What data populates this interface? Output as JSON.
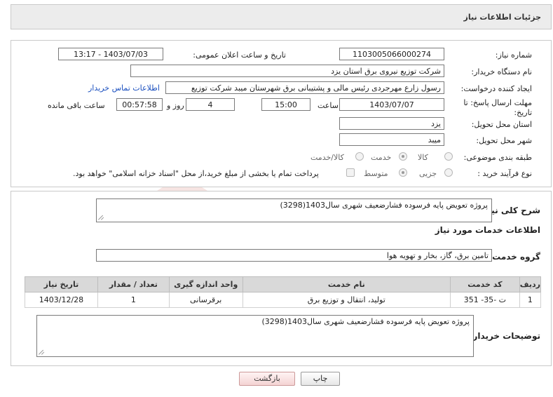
{
  "header": {
    "title": "جزئیات اطلاعات نیاز"
  },
  "fields": {
    "need_number_label": "شماره نیاز:",
    "need_number": "1103005066000274",
    "announce_label": "تاریخ و ساعت اعلان عمومی:",
    "announce_value": "1403/07/03 - 13:17",
    "buyer_org_label": "نام دستگاه خریدار:",
    "buyer_org": "شرکت توزیع نیروی برق استان یزد",
    "creator_label": "ایجاد کننده درخواست:",
    "creator": "رسول  زارع مهرجردی  رئیس مالی و پشتیبانی برق شهرستان میبد شرکت توزیع",
    "contact_link": "اطلاعات تماس خریدار",
    "deadline_label": "مهلت ارسال پاسخ: تا تاریخ:",
    "deadline_date": "1403/07/07",
    "time_label": "ساعت",
    "deadline_time": "15:00",
    "days_value": "4",
    "days_label": "روز و",
    "remaining_time": "00:57:58",
    "remaining_label": "ساعت باقی مانده",
    "province_label": "استان محل تحویل:",
    "province": "یزد",
    "city_label": "شهر محل تحویل:",
    "city": "میبد",
    "category_label": "طبقه بندی موضوعی:",
    "category_options": [
      "کالا",
      "خدمت",
      "کالا/خدمت"
    ],
    "category_selected": "خدمت",
    "purchase_label": "نوع فرآیند خرید :",
    "purchase_options": [
      "جزیی",
      "متوسط"
    ],
    "purchase_selected": "متوسط",
    "payment_note": "پرداخت تمام یا بخشی از مبلغ خرید،از محل \"اسناد خزانه اسلامی\" خواهد بود."
  },
  "description": {
    "summary_label": "شرح کلی نیاز:",
    "summary": "پروژه تعویض پایه فرسوده فشارضعیف شهری سال1403(3298)",
    "services_heading": "اطلاعات خدمات مورد نیاز",
    "group_label": "گروه خدمت:",
    "group_value": "تامین برق، گاز، بخار و تهویه هوا",
    "table": {
      "headers": [
        "ردیف",
        "کد خدمت",
        "نام خدمت",
        "واحد اندازه گیری",
        "تعداد / مقدار",
        "تاریخ نیاز"
      ],
      "rows": [
        [
          "1",
          "ت -35- 351",
          "تولید، انتقال و توزیع برق",
          "برقرسانی",
          "1",
          "1403/12/28"
        ]
      ]
    },
    "buyer_notes_label": "توضیحات خریدار:",
    "buyer_notes": "پروژه تعویض پایه فرسوده فشارضعیف شهری سال1403(3298)"
  },
  "buttons": {
    "print": "چاپ",
    "back": "بازگشت"
  },
  "watermark": {
    "text": "AriaTender.neT",
    "color": "#c0392b"
  }
}
